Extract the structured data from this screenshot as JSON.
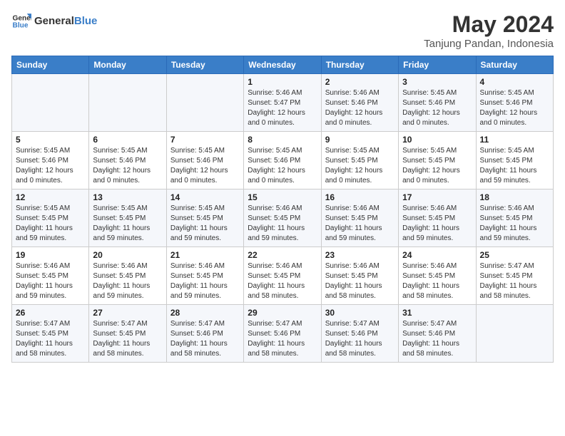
{
  "logo": {
    "line1": "General",
    "line2": "Blue"
  },
  "title": "May 2024",
  "subtitle": "Tanjung Pandan, Indonesia",
  "days_of_week": [
    "Sunday",
    "Monday",
    "Tuesday",
    "Wednesday",
    "Thursday",
    "Friday",
    "Saturday"
  ],
  "weeks": [
    [
      {
        "num": "",
        "detail": ""
      },
      {
        "num": "",
        "detail": ""
      },
      {
        "num": "",
        "detail": ""
      },
      {
        "num": "1",
        "detail": "Sunrise: 5:46 AM\nSunset: 5:47 PM\nDaylight: 12 hours\nand 0 minutes."
      },
      {
        "num": "2",
        "detail": "Sunrise: 5:46 AM\nSunset: 5:46 PM\nDaylight: 12 hours\nand 0 minutes."
      },
      {
        "num": "3",
        "detail": "Sunrise: 5:45 AM\nSunset: 5:46 PM\nDaylight: 12 hours\nand 0 minutes."
      },
      {
        "num": "4",
        "detail": "Sunrise: 5:45 AM\nSunset: 5:46 PM\nDaylight: 12 hours\nand 0 minutes."
      }
    ],
    [
      {
        "num": "5",
        "detail": "Sunrise: 5:45 AM\nSunset: 5:46 PM\nDaylight: 12 hours\nand 0 minutes."
      },
      {
        "num": "6",
        "detail": "Sunrise: 5:45 AM\nSunset: 5:46 PM\nDaylight: 12 hours\nand 0 minutes."
      },
      {
        "num": "7",
        "detail": "Sunrise: 5:45 AM\nSunset: 5:46 PM\nDaylight: 12 hours\nand 0 minutes."
      },
      {
        "num": "8",
        "detail": "Sunrise: 5:45 AM\nSunset: 5:46 PM\nDaylight: 12 hours\nand 0 minutes."
      },
      {
        "num": "9",
        "detail": "Sunrise: 5:45 AM\nSunset: 5:45 PM\nDaylight: 12 hours\nand 0 minutes."
      },
      {
        "num": "10",
        "detail": "Sunrise: 5:45 AM\nSunset: 5:45 PM\nDaylight: 12 hours\nand 0 minutes."
      },
      {
        "num": "11",
        "detail": "Sunrise: 5:45 AM\nSunset: 5:45 PM\nDaylight: 11 hours\nand 59 minutes."
      }
    ],
    [
      {
        "num": "12",
        "detail": "Sunrise: 5:45 AM\nSunset: 5:45 PM\nDaylight: 11 hours\nand 59 minutes."
      },
      {
        "num": "13",
        "detail": "Sunrise: 5:45 AM\nSunset: 5:45 PM\nDaylight: 11 hours\nand 59 minutes."
      },
      {
        "num": "14",
        "detail": "Sunrise: 5:45 AM\nSunset: 5:45 PM\nDaylight: 11 hours\nand 59 minutes."
      },
      {
        "num": "15",
        "detail": "Sunrise: 5:46 AM\nSunset: 5:45 PM\nDaylight: 11 hours\nand 59 minutes."
      },
      {
        "num": "16",
        "detail": "Sunrise: 5:46 AM\nSunset: 5:45 PM\nDaylight: 11 hours\nand 59 minutes."
      },
      {
        "num": "17",
        "detail": "Sunrise: 5:46 AM\nSunset: 5:45 PM\nDaylight: 11 hours\nand 59 minutes."
      },
      {
        "num": "18",
        "detail": "Sunrise: 5:46 AM\nSunset: 5:45 PM\nDaylight: 11 hours\nand 59 minutes."
      }
    ],
    [
      {
        "num": "19",
        "detail": "Sunrise: 5:46 AM\nSunset: 5:45 PM\nDaylight: 11 hours\nand 59 minutes."
      },
      {
        "num": "20",
        "detail": "Sunrise: 5:46 AM\nSunset: 5:45 PM\nDaylight: 11 hours\nand 59 minutes."
      },
      {
        "num": "21",
        "detail": "Sunrise: 5:46 AM\nSunset: 5:45 PM\nDaylight: 11 hours\nand 59 minutes."
      },
      {
        "num": "22",
        "detail": "Sunrise: 5:46 AM\nSunset: 5:45 PM\nDaylight: 11 hours\nand 58 minutes."
      },
      {
        "num": "23",
        "detail": "Sunrise: 5:46 AM\nSunset: 5:45 PM\nDaylight: 11 hours\nand 58 minutes."
      },
      {
        "num": "24",
        "detail": "Sunrise: 5:46 AM\nSunset: 5:45 PM\nDaylight: 11 hours\nand 58 minutes."
      },
      {
        "num": "25",
        "detail": "Sunrise: 5:47 AM\nSunset: 5:45 PM\nDaylight: 11 hours\nand 58 minutes."
      }
    ],
    [
      {
        "num": "26",
        "detail": "Sunrise: 5:47 AM\nSunset: 5:45 PM\nDaylight: 11 hours\nand 58 minutes."
      },
      {
        "num": "27",
        "detail": "Sunrise: 5:47 AM\nSunset: 5:45 PM\nDaylight: 11 hours\nand 58 minutes."
      },
      {
        "num": "28",
        "detail": "Sunrise: 5:47 AM\nSunset: 5:46 PM\nDaylight: 11 hours\nand 58 minutes."
      },
      {
        "num": "29",
        "detail": "Sunrise: 5:47 AM\nSunset: 5:46 PM\nDaylight: 11 hours\nand 58 minutes."
      },
      {
        "num": "30",
        "detail": "Sunrise: 5:47 AM\nSunset: 5:46 PM\nDaylight: 11 hours\nand 58 minutes."
      },
      {
        "num": "31",
        "detail": "Sunrise: 5:47 AM\nSunset: 5:46 PM\nDaylight: 11 hours\nand 58 minutes."
      },
      {
        "num": "",
        "detail": ""
      }
    ]
  ]
}
